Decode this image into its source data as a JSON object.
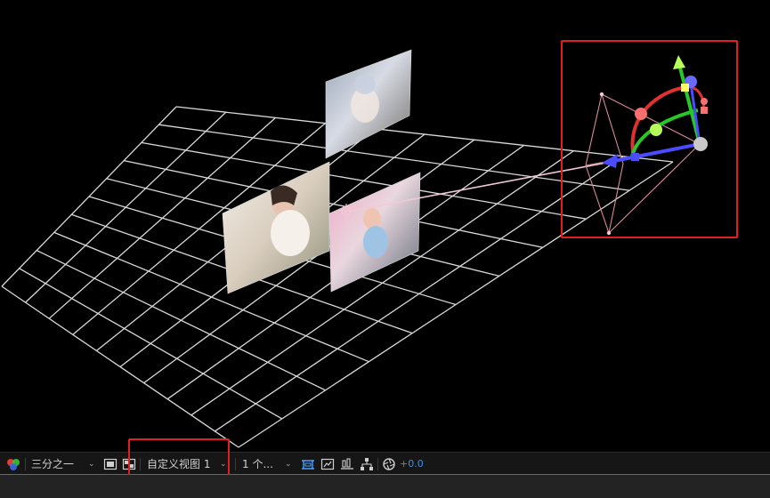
{
  "toolbar": {
    "grid_dropdown": "三分之一",
    "view_dropdown": "自定义视图 1",
    "views_dropdown": "1 个...",
    "exposure_value": "+0.0"
  },
  "icons": [
    "color-channels-icon",
    "safe-area-icon",
    "transparency-grid-icon",
    "3d-draft-icon",
    "flowchart-icon",
    "timeline-icon",
    "node-graph-icon",
    "reset-exposure-icon"
  ],
  "colors": {
    "viewport_bg": "#000000",
    "grid_line": "#d9d9d9",
    "camera_line": "#f2c9d4",
    "x_axis": "#4b4bff",
    "y_axis": "#28c828",
    "z_axis": "#e03030",
    "highlight": "#e0201c",
    "accent": "#2d6fd8"
  }
}
